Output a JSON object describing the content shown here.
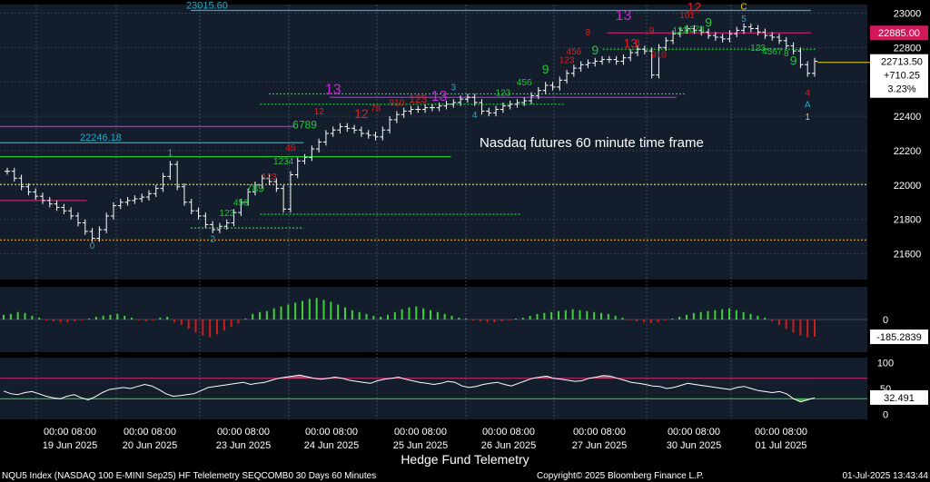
{
  "chart_data": {
    "type": "line",
    "annotation": "Nasdaq futures 60 minute time frame",
    "footer": {
      "left": "NQU5 Index (NASDAQ 100 E-MINI Sep25) HF Telelemetry SEQCOMB0 30 Days 60 Minutes",
      "center": "Copyright© 2025 Bloomberg Finance L.P.",
      "right": "01-Jul-2025 13:43:44",
      "title": "Hedge Fund Telemetry"
    },
    "date_labels": [
      {
        "time": "00:00 08:00",
        "date": "19 Jun 2025"
      },
      {
        "time": "00:00 08:00",
        "date": "20 Jun 2025"
      },
      {
        "time": "00:00 08:00",
        "date": "23 Jun 2025"
      },
      {
        "time": "00:00 08:00",
        "date": "24 Jun 2025"
      },
      {
        "time": "00:00 08:00",
        "date": "25 Jun 2025"
      },
      {
        "time": "00:00 08:00",
        "date": "26 Jun 2025"
      },
      {
        "time": "00:00 08:00",
        "date": "27 Jun 2025"
      },
      {
        "time": "00:00 08:00",
        "date": "30 Jun 2025"
      },
      {
        "time": "00:00 08:00",
        "date": "01 Jul 2025"
      }
    ],
    "price_panel": {
      "ylim": [
        21450,
        23050
      ],
      "ticks": [
        21600,
        21800,
        22000,
        22200,
        22400,
        22600,
        22800,
        23000
      ],
      "last": {
        "price": "22713.50",
        "change": "+710.25",
        "pct": "3.23%"
      },
      "level_tag": "22885.00",
      "level_labels": [
        {
          "text": "23015.60",
          "value": 23015.6
        },
        {
          "text": "22246.18",
          "value": 22246.18
        }
      ],
      "closes": [
        22080,
        22040,
        21990,
        21960,
        21935,
        21910,
        21890,
        21870,
        21850,
        21820,
        21780,
        21730,
        21690,
        21740,
        21820,
        21880,
        21900,
        21910,
        21920,
        21930,
        21950,
        21980,
        22050,
        22120,
        21990,
        21900,
        21850,
        21820,
        21770,
        21740,
        21760,
        21780,
        21840,
        21900,
        21960,
        22000,
        22040,
        22020,
        21980,
        21860,
        22060,
        22140,
        22160,
        22210,
        22250,
        22300,
        22320,
        22340,
        22330,
        22320,
        22300,
        22290,
        22280,
        22320,
        22380,
        22410,
        22430,
        22440,
        22440,
        22450,
        22450,
        22460,
        22470,
        22480,
        22500,
        22510,
        22480,
        22430,
        22420,
        22440,
        22460,
        22470,
        22480,
        22490,
        22520,
        22550,
        22580,
        22570,
        22610,
        22650,
        22680,
        22700,
        22710,
        22720,
        22730,
        22730,
        22720,
        22740,
        22770,
        22790,
        22780,
        22640,
        22800,
        22840,
        22880,
        22900,
        22910,
        22900,
        22890,
        22870,
        22860,
        22850,
        22880,
        22900,
        22920,
        22910,
        22890,
        22870,
        22860,
        22840,
        22810,
        22780,
        22700,
        22650,
        22720
      ],
      "lines": [
        {
          "value": 23015.6,
          "x0": 0.22,
          "x1": 0.935,
          "color": "#2aa9c4",
          "style": "solid"
        },
        {
          "value": 22885.0,
          "x0": 0.7,
          "x1": 0.935,
          "color": "#c0206a",
          "style": "solid"
        },
        {
          "value": 22790.0,
          "x0": 0.695,
          "x1": 0.94,
          "color": "#21c83a",
          "style": "dotted"
        },
        {
          "value": 22530.0,
          "x0": 0.31,
          "x1": 0.79,
          "color": "#21c83a",
          "style": "dotted"
        },
        {
          "value": 22470.0,
          "x0": 0.3,
          "x1": 0.65,
          "color": "#21c83a",
          "style": "dotted"
        },
        {
          "value": 22510.0,
          "x0": 0.38,
          "x1": 0.78,
          "color": "#a62fd0",
          "style": "solid"
        },
        {
          "value": 22340.0,
          "x0": 0.0,
          "x1": 0.34,
          "color": "#a62fd0",
          "style": "solid"
        },
        {
          "value": 22246.18,
          "x0": 0.0,
          "x1": 0.35,
          "color": "#2aa9c4",
          "style": "solid"
        },
        {
          "value": 22165.0,
          "x0": 0.0,
          "x1": 0.52,
          "color": "#21c83a",
          "style": "solid"
        },
        {
          "value": 22003.0,
          "x0": 0.0,
          "x1": 1.0,
          "color": "#e8d21c",
          "style": "dotted"
        },
        {
          "value": 21910.0,
          "x0": 0.0,
          "x1": 0.1,
          "color": "#c0206a",
          "style": "solid"
        },
        {
          "value": 21830.0,
          "x0": 0.3,
          "x1": 0.6,
          "color": "#21c83a",
          "style": "dotted"
        },
        {
          "value": 21750.0,
          "x0": 0.22,
          "x1": 0.35,
          "color": "#21c83a",
          "style": "dotted"
        },
        {
          "value": 21680.0,
          "x0": 0.0,
          "x1": 1.0,
          "color": "#c8902a",
          "style": "dotted"
        }
      ],
      "markers": [
        {
          "text": "0",
          "i": 12,
          "v": 21630,
          "color": "#2aa9c4",
          "size": 10
        },
        {
          "text": "1",
          "i": 23,
          "v": 22170,
          "color": "#2aa9c4",
          "size": 10
        },
        {
          "text": "2",
          "i": 29,
          "v": 21670,
          "color": "#2aa9c4",
          "size": 10
        },
        {
          "text": "123",
          "i": 31,
          "v": 21820,
          "color": "#21c83a",
          "size": 10
        },
        {
          "text": "456",
          "i": 33,
          "v": 21880,
          "color": "#21c83a",
          "size": 10
        },
        {
          "text": "789",
          "i": 35,
          "v": 21960,
          "color": "#21c83a",
          "size": 12
        },
        {
          "text": "123",
          "i": 37,
          "v": 22030,
          "color": "#e02020",
          "size": 10
        },
        {
          "text": "1234",
          "i": 39,
          "v": 22120,
          "color": "#21c83a",
          "size": 10
        },
        {
          "text": "45",
          "i": 40,
          "v": 22200,
          "color": "#e02020",
          "size": 10
        },
        {
          "text": "6789",
          "i": 42,
          "v": 22330,
          "color": "#21c83a",
          "size": 12
        },
        {
          "text": "12",
          "i": 44,
          "v": 22410,
          "color": "#e02020",
          "size": 10
        },
        {
          "text": "13",
          "i": 46,
          "v": 22530,
          "color": "#c82ad0",
          "size": 16
        },
        {
          "text": "12",
          "i": 50,
          "v": 22390,
          "color": "#e02020",
          "size": 14
        },
        {
          "text": "78",
          "i": 52,
          "v": 22430,
          "color": "#e02020",
          "size": 10
        },
        {
          "text": "910",
          "i": 55,
          "v": 22460,
          "color": "#e02020",
          "size": 10
        },
        {
          "text": "123",
          "i": 58,
          "v": 22480,
          "color": "#e02020",
          "size": 12
        },
        {
          "text": "13",
          "i": 61,
          "v": 22490,
          "color": "#c82ad0",
          "size": 16
        },
        {
          "text": "3",
          "i": 63,
          "v": 22550,
          "color": "#2aa9c4",
          "size": 10
        },
        {
          "text": "4",
          "i": 66,
          "v": 22390,
          "color": "#2aa9c4",
          "size": 10
        },
        {
          "text": "123",
          "i": 70,
          "v": 22520,
          "color": "#21c83a",
          "size": 10
        },
        {
          "text": "456",
          "i": 73,
          "v": 22580,
          "color": "#21c83a",
          "size": 10
        },
        {
          "text": "9",
          "i": 76,
          "v": 22650,
          "color": "#21c83a",
          "size": 14
        },
        {
          "text": "123",
          "i": 79,
          "v": 22710,
          "color": "#e02020",
          "size": 10
        },
        {
          "text": "456",
          "i": 80,
          "v": 22760,
          "color": "#e02020",
          "size": 10
        },
        {
          "text": "8",
          "i": 82,
          "v": 22870,
          "color": "#e02020",
          "size": 10
        },
        {
          "text": "9",
          "i": 83,
          "v": 22760,
          "color": "#21c83a",
          "size": 14
        },
        {
          "text": "13",
          "i": 87,
          "v": 22960,
          "color": "#c82ad0",
          "size": 16
        },
        {
          "text": "13",
          "i": 88,
          "v": 22800,
          "color": "#e02020",
          "size": 14
        },
        {
          "text": "8",
          "i": 89,
          "v": 22810,
          "color": "#e02020",
          "size": 10
        },
        {
          "text": "9",
          "i": 91,
          "v": 22880,
          "color": "#e02020",
          "size": 10
        },
        {
          "text": "910",
          "i": 92,
          "v": 22740,
          "color": "#e02020",
          "size": 10
        },
        {
          "text": "123",
          "i": 95,
          "v": 22880,
          "color": "#21c83a",
          "size": 10
        },
        {
          "text": "101",
          "i": 96,
          "v": 22970,
          "color": "#e02020",
          "size": 10
        },
        {
          "text": "12",
          "i": 97,
          "v": 23010,
          "color": "#e02020",
          "size": 14
        },
        {
          "text": "5678",
          "i": 97,
          "v": 22890,
          "color": "#21c83a",
          "size": 10
        },
        {
          "text": "9",
          "i": 99,
          "v": 22920,
          "color": "#21c83a",
          "size": 14
        },
        {
          "text": "C",
          "i": 104,
          "v": 23020,
          "color": "#e8d21c",
          "size": 10
        },
        {
          "text": "5",
          "i": 104,
          "v": 22950,
          "color": "#2aa9c4",
          "size": 10
        },
        {
          "text": "123",
          "i": 106,
          "v": 22780,
          "color": "#21c83a",
          "size": 10
        },
        {
          "text": "4567",
          "i": 108,
          "v": 22760,
          "color": "#21c83a",
          "size": 10
        },
        {
          "text": "8",
          "i": 110,
          "v": 22750,
          "color": "#21c83a",
          "size": 10
        },
        {
          "text": "9",
          "i": 111,
          "v": 22700,
          "color": "#21c83a",
          "size": 14
        },
        {
          "text": "4",
          "i": 113,
          "v": 22520,
          "color": "#e02020",
          "size": 10
        },
        {
          "text": "A",
          "i": 113,
          "v": 22450,
          "color": "#2aa9c4",
          "size": 10
        },
        {
          "text": "1",
          "i": 113,
          "v": 22380,
          "color": "#e8d21c",
          "size": 10
        }
      ]
    },
    "histogram_panel": {
      "ylim": [
        -350,
        350
      ],
      "ticks": [
        0
      ],
      "last": "-185.2839",
      "values": [
        50,
        60,
        80,
        70,
        40,
        20,
        -10,
        -20,
        -30,
        -30,
        -20,
        -10,
        10,
        30,
        40,
        50,
        60,
        40,
        20,
        -10,
        -20,
        -10,
        20,
        30,
        -30,
        -60,
        -100,
        -140,
        -170,
        -190,
        -160,
        -120,
        -80,
        -40,
        10,
        60,
        80,
        90,
        120,
        140,
        160,
        180,
        200,
        220,
        230,
        210,
        190,
        160,
        130,
        100,
        80,
        60,
        40,
        30,
        50,
        80,
        110,
        130,
        140,
        120,
        100,
        80,
        60,
        40,
        20,
        10,
        -10,
        -20,
        -30,
        -30,
        -20,
        -10,
        10,
        20,
        40,
        60,
        70,
        80,
        90,
        100,
        110,
        100,
        90,
        80,
        70,
        60,
        40,
        20,
        -10,
        -20,
        -30,
        -40,
        -30,
        -10,
        10,
        30,
        50,
        70,
        80,
        90,
        100,
        110,
        120,
        100,
        80,
        60,
        40,
        20,
        -20,
        -60,
        -100,
        -140,
        -170,
        -190,
        -185
      ],
      "colors": {
        "positive": "#3fd13a",
        "negative": "#d21c1c"
      }
    },
    "rsi_panel": {
      "ylim": [
        -10,
        110
      ],
      "ticks": [
        0,
        50,
        100
      ],
      "last": "32.491",
      "upper": 70,
      "lower": 30,
      "values": [
        45,
        40,
        38,
        42,
        44,
        40,
        35,
        32,
        30,
        35,
        38,
        32,
        28,
        34,
        42,
        48,
        50,
        52,
        50,
        54,
        58,
        55,
        48,
        40,
        35,
        36,
        38,
        40,
        46,
        52,
        54,
        56,
        58,
        60,
        62,
        58,
        60,
        62,
        66,
        70,
        72,
        74,
        76,
        73,
        70,
        68,
        70,
        72,
        70,
        66,
        64,
        62,
        60,
        65,
        68,
        70,
        72,
        68,
        65,
        62,
        60,
        58,
        60,
        64,
        62,
        55,
        52,
        54,
        58,
        60,
        62,
        58,
        55,
        60,
        65,
        70,
        72,
        74,
        70,
        68,
        66,
        64,
        65,
        70,
        72,
        75,
        74,
        70,
        66,
        62,
        60,
        58,
        55,
        54,
        50,
        52,
        56,
        60,
        58,
        56,
        54,
        52,
        50,
        48,
        52,
        54,
        50,
        46,
        44,
        42,
        44,
        40,
        30,
        24,
        28,
        32
      ]
    }
  }
}
